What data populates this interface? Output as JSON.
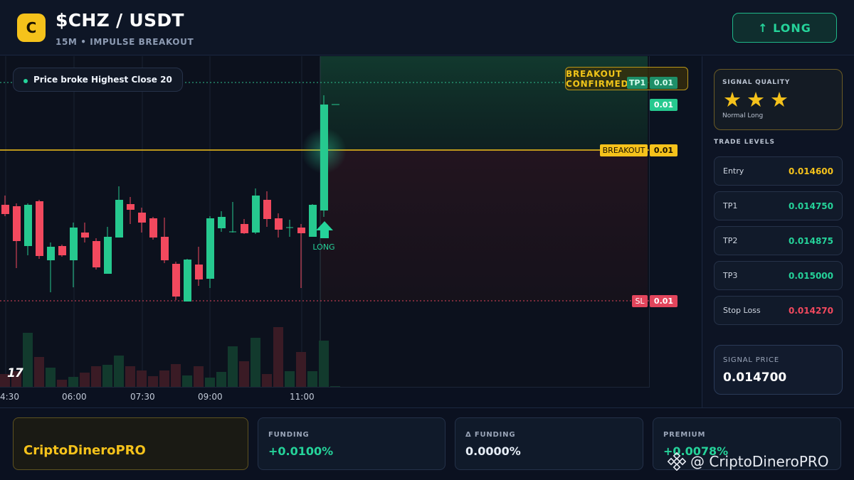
{
  "header": {
    "coin_letter": "C",
    "pair": "$CHZ / USDT",
    "subtitle": "15M • IMPULSE BREAKOUT",
    "direction_button": "↑ LONG"
  },
  "chart": {
    "note": "Price broke Highest Close 20",
    "confirm_badge": "BREAKOUT CONFIRMED",
    "signal_marker": "LONG",
    "level_tags": {
      "tp1_label": "TP1",
      "tp1_value": "0.01",
      "last_value": "0.01",
      "breakout_label": "BREAKOUT",
      "breakout_value": "0.01",
      "sl_label": "SL",
      "sl_value": "0.01"
    },
    "time_labels": [
      "4:30",
      "06:00",
      "07:30",
      "09:00",
      "11:00"
    ],
    "tv_logo": "17",
    "colors": {
      "up": "#26c98f",
      "down": "#f2495e",
      "breakout": "#f5c21b",
      "tp_line": "#2fbf8f",
      "sl_line": "#e2455c"
    }
  },
  "chart_data": {
    "type": "candlestick",
    "x": [
      "4:30",
      "06:00",
      "07:30",
      "09:00",
      "11:00"
    ],
    "candle_colors": [
      "down",
      "down",
      "up",
      "down",
      "up",
      "down",
      "up",
      "down",
      "down",
      "up",
      "up",
      "down",
      "down",
      "down",
      "down",
      "down",
      "up",
      "up",
      "down",
      "up",
      "up",
      "down",
      "up",
      "down",
      "down",
      "up",
      "down",
      "up",
      "up"
    ],
    "levels": {
      "tp1": 0.01475,
      "breakout": 0.0146,
      "sl": 0.01427
    }
  },
  "side_panel": {
    "quality_title": "SIGNAL QUALITY",
    "quality_stars": 3,
    "quality_label": "Normal Long",
    "levels_title": "TRADE LEVELS",
    "levels": [
      {
        "label": "Entry",
        "value": "0.014600",
        "color": "#f5c21b"
      },
      {
        "label": "TP1",
        "value": "0.014750",
        "color": "#25d39a"
      },
      {
        "label": "TP2",
        "value": "0.014875",
        "color": "#25d39a"
      },
      {
        "label": "TP3",
        "value": "0.015000",
        "color": "#25d39a"
      },
      {
        "label": "Stop Loss",
        "value": "0.014270",
        "color": "#f2495e"
      }
    ],
    "signal_price_title": "SIGNAL PRICE",
    "signal_price": "0.014700"
  },
  "footer": {
    "brand": "CriptoDineroPRO",
    "stats": [
      {
        "title": "FUNDING",
        "value": "+0.0100%",
        "color": "#25d39a"
      },
      {
        "title": "Δ FUNDING",
        "value": "0.0000%",
        "color": "#e6edf6"
      },
      {
        "title": "PREMIUM",
        "value": "+0.0078%",
        "color": "#25d39a"
      }
    ],
    "watermark": "@ CriptoDineroPRO"
  }
}
